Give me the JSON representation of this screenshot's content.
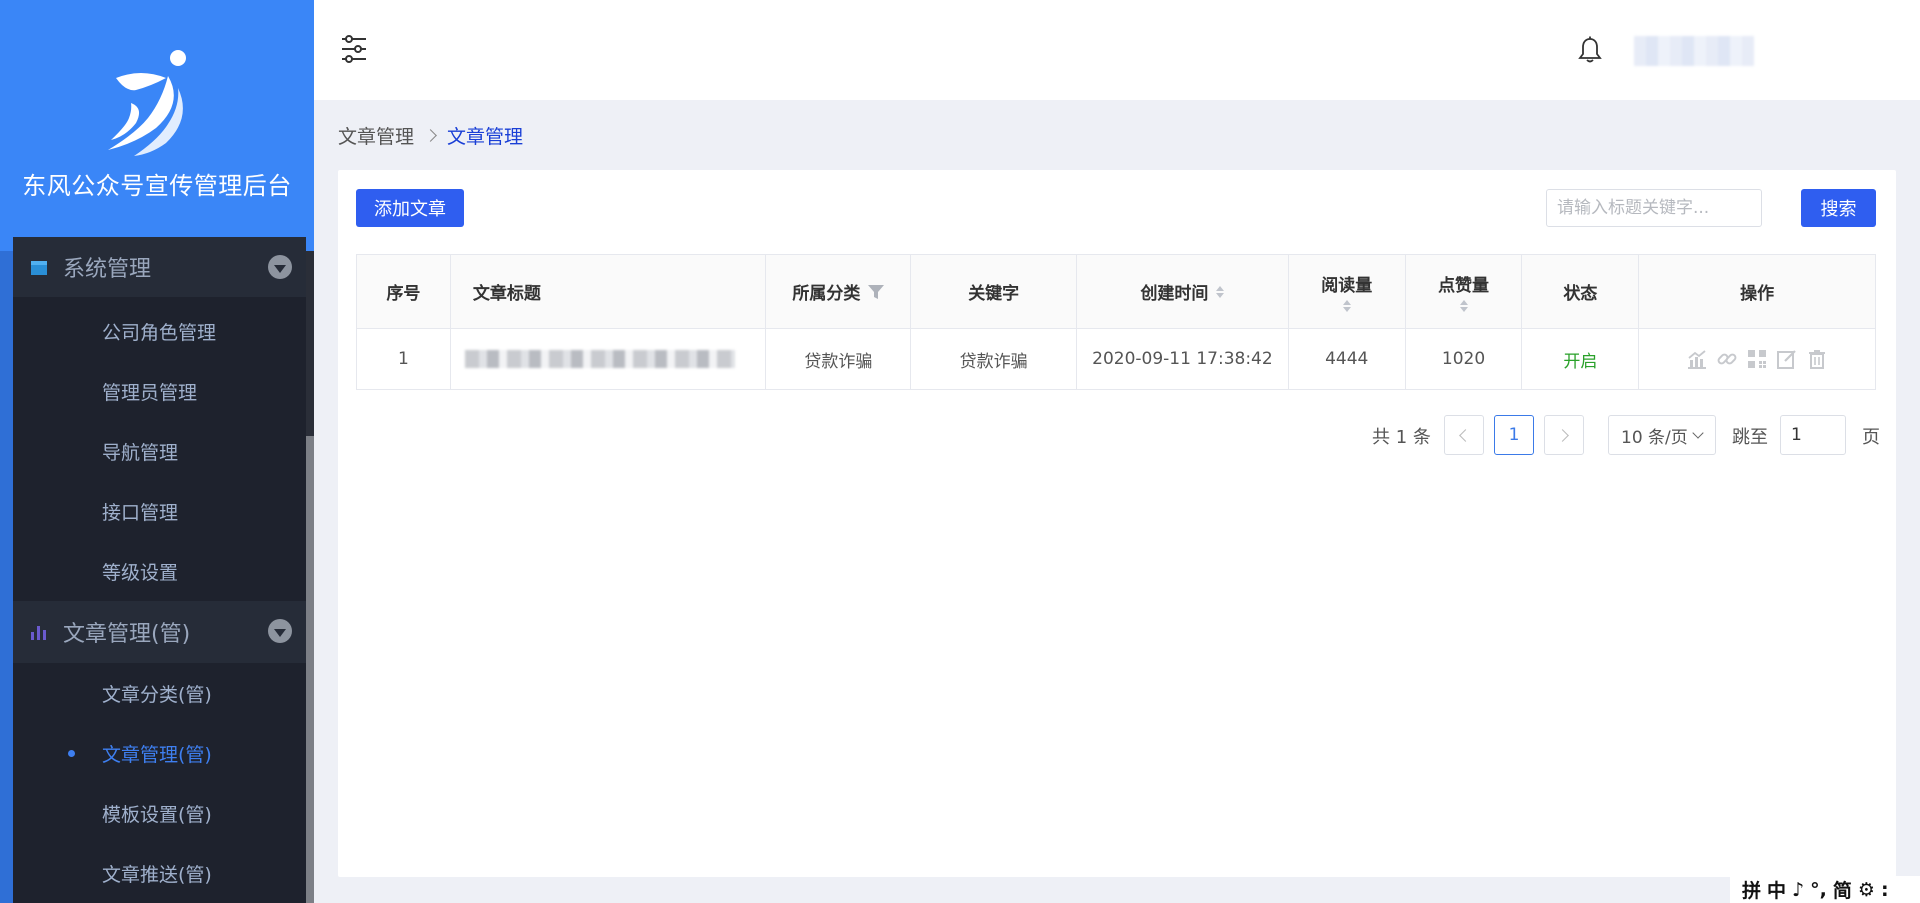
{
  "brand": {
    "title": "东风公众号宣传管理后台"
  },
  "sidebar": {
    "groups": [
      {
        "label": "系统管理",
        "items": [
          "公司角色管理",
          "管理员管理",
          "导航管理",
          "接口管理",
          "等级设置"
        ]
      },
      {
        "label": "文章管理(管)",
        "items": [
          "文章分类(管)",
          "文章管理(管)",
          "模板设置(管)",
          "文章推送(管)"
        ]
      }
    ],
    "active_item": "文章管理(管)"
  },
  "breadcrumb": {
    "parent": "文章管理",
    "current": "文章管理"
  },
  "toolbar": {
    "add_label": "添加文章",
    "search_placeholder": "请输入标题关键字...",
    "search_label": "搜索"
  },
  "table": {
    "headers": {
      "index": "序号",
      "title": "文章标题",
      "category": "所属分类",
      "keyword": "关键字",
      "created": "创建时间",
      "reads": "阅读量",
      "likes": "点赞量",
      "status": "状态",
      "ops": "操作"
    },
    "rows": [
      {
        "index": "1",
        "category": "贷款诈骗",
        "keyword": "贷款诈骗",
        "created": "2020-09-11 17:38:42",
        "reads": "4444",
        "likes": "1020",
        "status": "开启"
      }
    ],
    "row_action_icons": [
      "stats-icon",
      "link-icon",
      "qrcode-icon",
      "edit-icon",
      "delete-icon"
    ]
  },
  "pagination": {
    "total_text": "共 1 条",
    "current_page": "1",
    "page_size": "10 条/页",
    "jump_label": "跳至",
    "jump_value": "1",
    "page_unit": "页"
  },
  "ime": {
    "chars": [
      "拼",
      "中",
      "♪",
      "°,",
      "简",
      "⚙",
      ":"
    ]
  },
  "colors": {
    "brand": "#3a86f7",
    "primary": "#2f5ef0",
    "sidebar": "#1e222d",
    "status_open": "#2aa12a"
  }
}
